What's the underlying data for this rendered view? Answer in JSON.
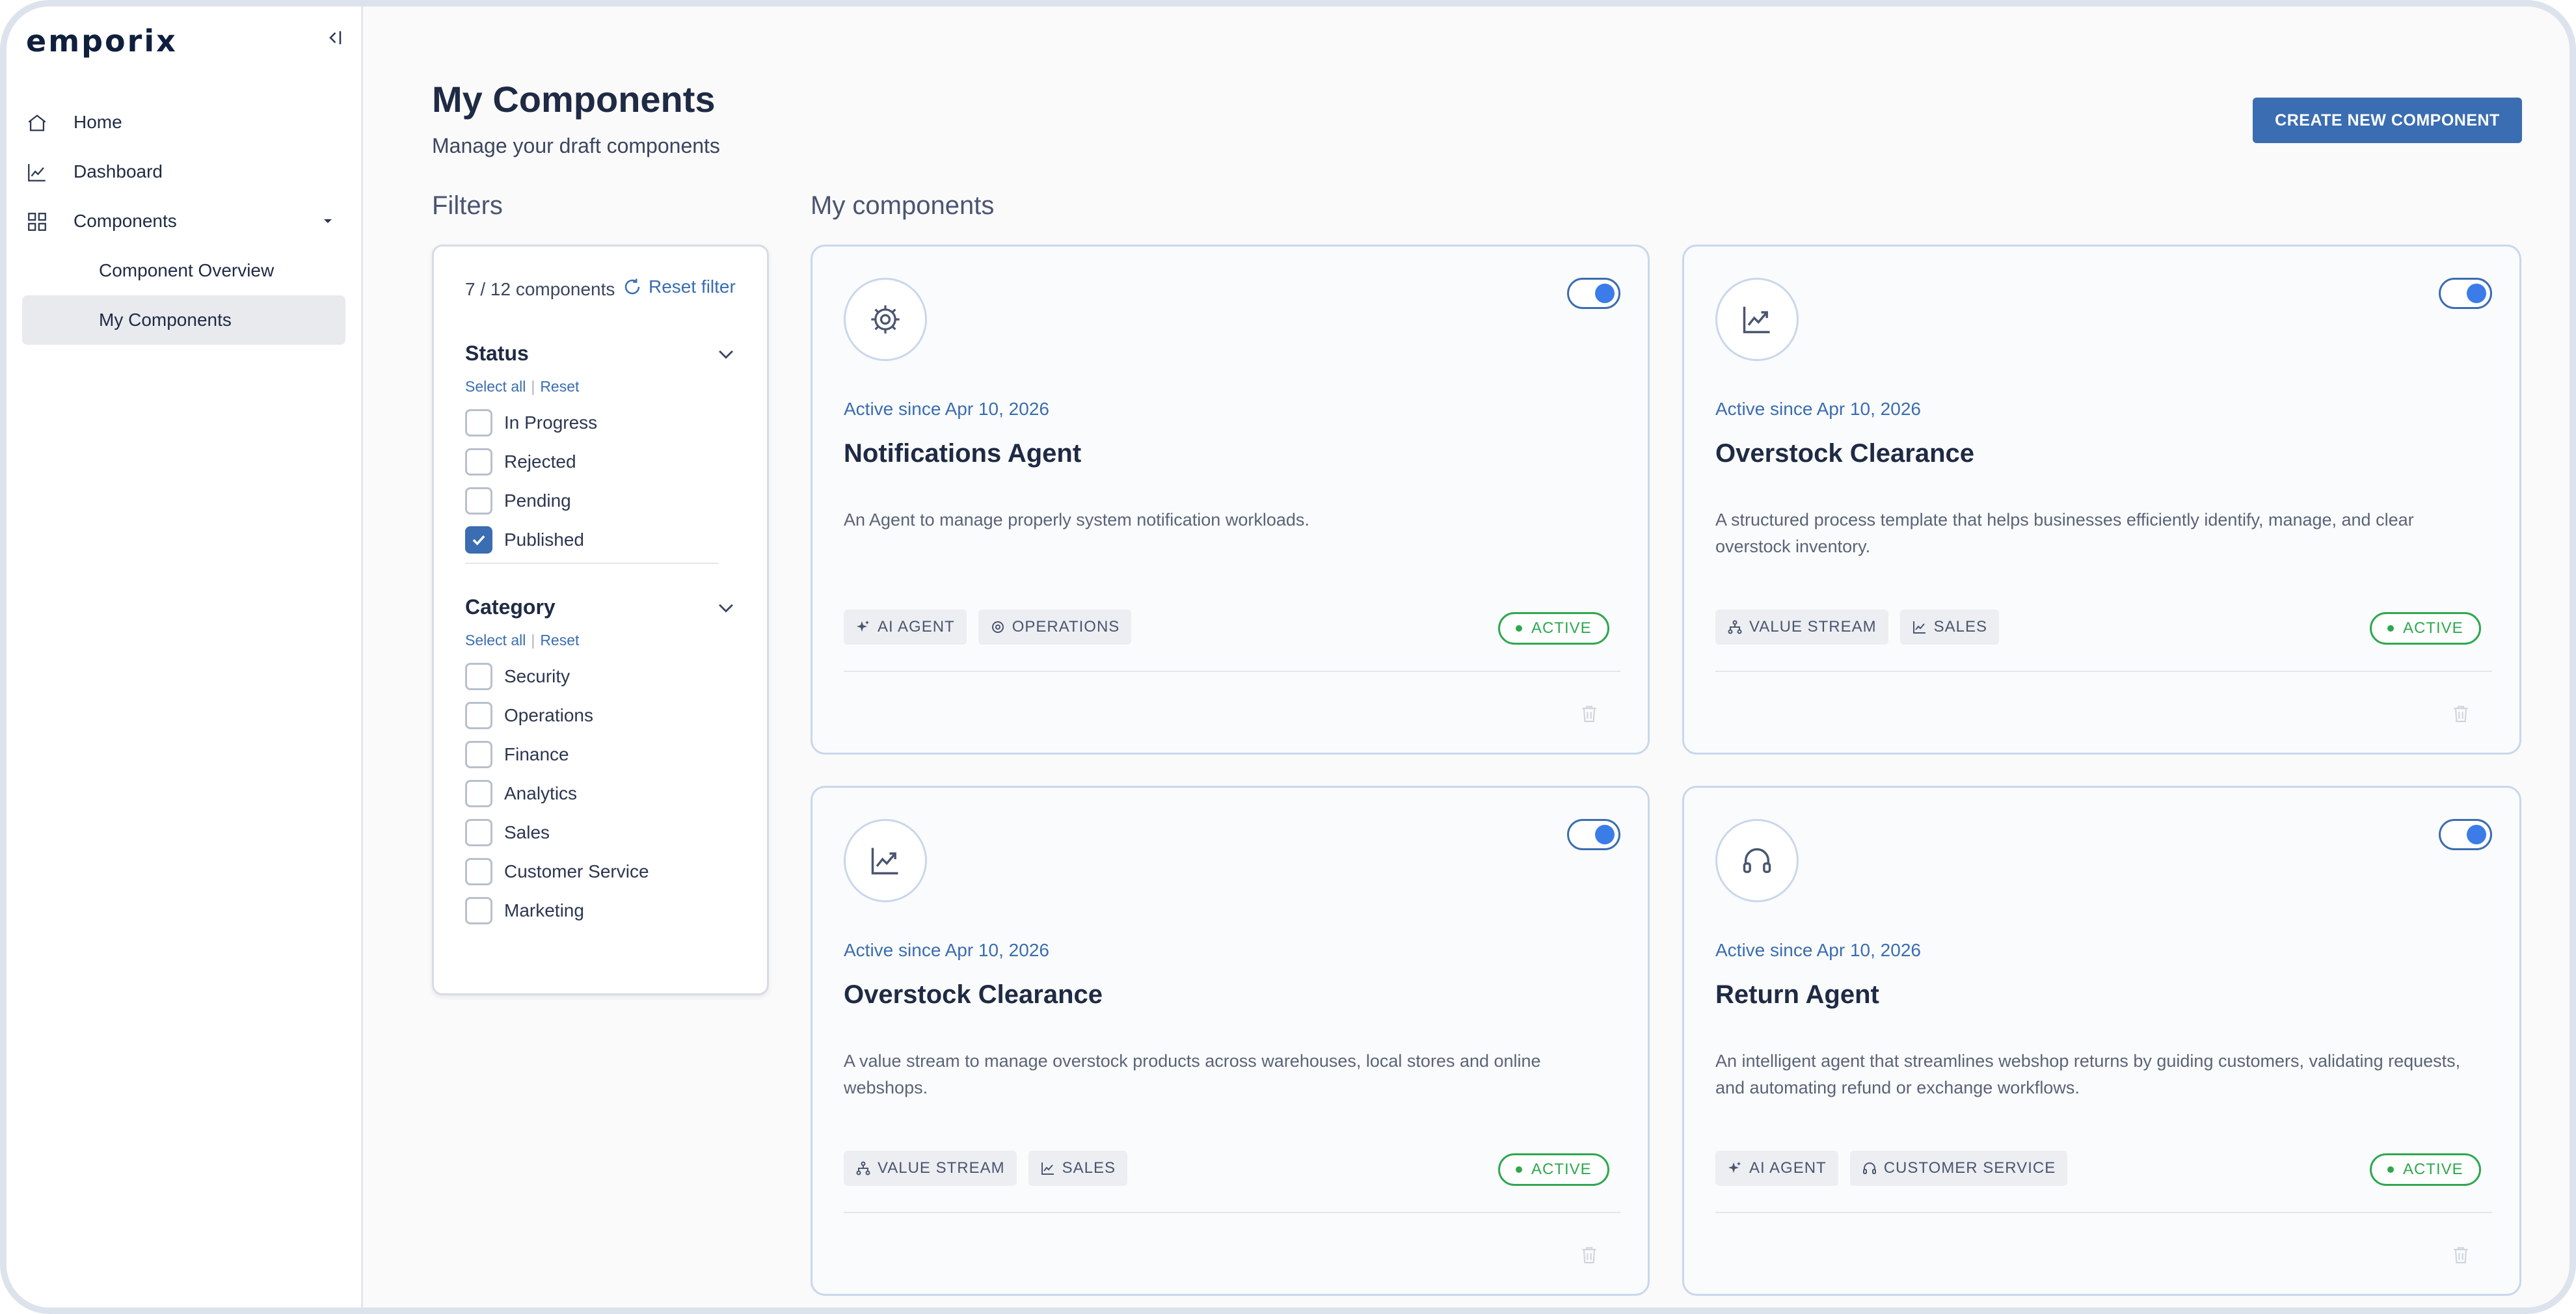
{
  "app": {
    "logo": "emporix"
  },
  "sidebar": {
    "items": [
      {
        "label": "Home"
      },
      {
        "label": "Dashboard"
      },
      {
        "label": "Components"
      }
    ],
    "sub_items": [
      {
        "label": "Component Overview"
      },
      {
        "label": "My Components",
        "active": true
      }
    ]
  },
  "header": {
    "title": "My Components",
    "subtitle": "Manage your draft components",
    "create_button": "CREATE NEW COMPONENT"
  },
  "filters": {
    "title": "Filters",
    "count": "7 / 12 components",
    "reset_filter": "Reset filter",
    "status": {
      "title": "Status",
      "select_all": "Select all",
      "reset": "Reset",
      "options": [
        {
          "label": "In Progress",
          "checked": false
        },
        {
          "label": "Rejected",
          "checked": false
        },
        {
          "label": "Pending",
          "checked": false
        },
        {
          "label": "Published",
          "checked": true
        }
      ]
    },
    "category": {
      "title": "Category",
      "select_all": "Select all",
      "reset": "Reset",
      "options": [
        {
          "label": "Security",
          "checked": false
        },
        {
          "label": "Operations",
          "checked": false
        },
        {
          "label": "Finance",
          "checked": false
        },
        {
          "label": "Analytics",
          "checked": false
        },
        {
          "label": "Sales",
          "checked": false
        },
        {
          "label": "Customer Service",
          "checked": false
        },
        {
          "label": "Marketing",
          "checked": false
        }
      ]
    }
  },
  "components_section": {
    "title": "My components",
    "cards": [
      {
        "icon": "gear-icon",
        "enabled": true,
        "since": "Active since Apr 10, 2026",
        "title": "Notifications Agent",
        "description": "An Agent to manage properly system notification workloads.",
        "tags": [
          {
            "label": "AI AGENT",
            "icon": "sparkle-icon"
          },
          {
            "label": "OPERATIONS",
            "icon": "gear-icon"
          }
        ],
        "status": "ACTIVE"
      },
      {
        "icon": "chart-icon",
        "enabled": true,
        "since": "Active since Apr 10, 2026",
        "title": "Overstock Clearance",
        "description": "A structured process template that helps businesses efficiently identify, manage, and clear overstock inventory.",
        "tags": [
          {
            "label": "VALUE STREAM",
            "icon": "hierarchy-icon"
          },
          {
            "label": "SALES",
            "icon": "chart-icon"
          }
        ],
        "status": "ACTIVE"
      },
      {
        "icon": "chart-icon",
        "enabled": true,
        "since": "Active since Apr 10, 2026",
        "title": "Overstock Clearance",
        "description": "A value stream to manage overstock products across warehouses, local stores and online webshops.",
        "tags": [
          {
            "label": "VALUE STREAM",
            "icon": "hierarchy-icon"
          },
          {
            "label": "SALES",
            "icon": "chart-icon"
          }
        ],
        "status": "ACTIVE"
      },
      {
        "icon": "headset-icon",
        "enabled": true,
        "since": "Active since Apr 10, 2026",
        "title": "Return Agent",
        "description": "An intelligent agent that streamlines webshop returns by guiding customers, validating requests, and automating refund or exchange workflows.",
        "tags": [
          {
            "label": "AI AGENT",
            "icon": "sparkle-icon"
          },
          {
            "label": "CUSTOMER SERVICE",
            "icon": "headset-icon"
          }
        ],
        "status": "ACTIVE"
      }
    ]
  },
  "colors": {
    "accent": "#3a6db1",
    "active_green": "#2ea84f",
    "toggle_knob": "#3b7ce8"
  }
}
